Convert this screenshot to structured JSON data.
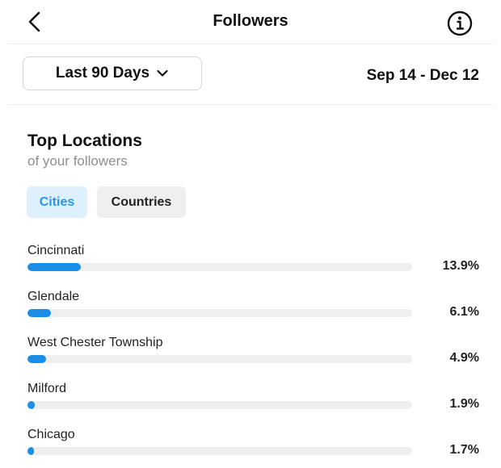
{
  "header": {
    "title": "Followers",
    "back_icon": "chevron-left-icon",
    "info_icon": "info-icon"
  },
  "filters": {
    "range_label": "Last 90 Days",
    "range_icon": "chevron-down-icon",
    "date_range": "Sep 14 - Dec 12"
  },
  "locations": {
    "title": "Top Locations",
    "subtitle": "of your followers",
    "tabs": [
      {
        "label": "Cities",
        "selected": true
      },
      {
        "label": "Countries",
        "selected": false
      }
    ],
    "items": [
      {
        "name": "Cincinnati",
        "percent_label": "13.9%",
        "percent": 13.9
      },
      {
        "name": "Glendale",
        "percent_label": "6.1%",
        "percent": 6.1
      },
      {
        "name": "West Chester Township",
        "percent_label": "4.9%",
        "percent": 4.9
      },
      {
        "name": "Milford",
        "percent_label": "1.9%",
        "percent": 1.9
      },
      {
        "name": "Chicago",
        "percent_label": "1.7%",
        "percent": 1.7
      }
    ]
  },
  "colors": {
    "accent": "#1a8ee8",
    "tab_selected_bg": "#dff0fd",
    "tab_selected_text": "#2a97e5",
    "track": "#efefef"
  }
}
